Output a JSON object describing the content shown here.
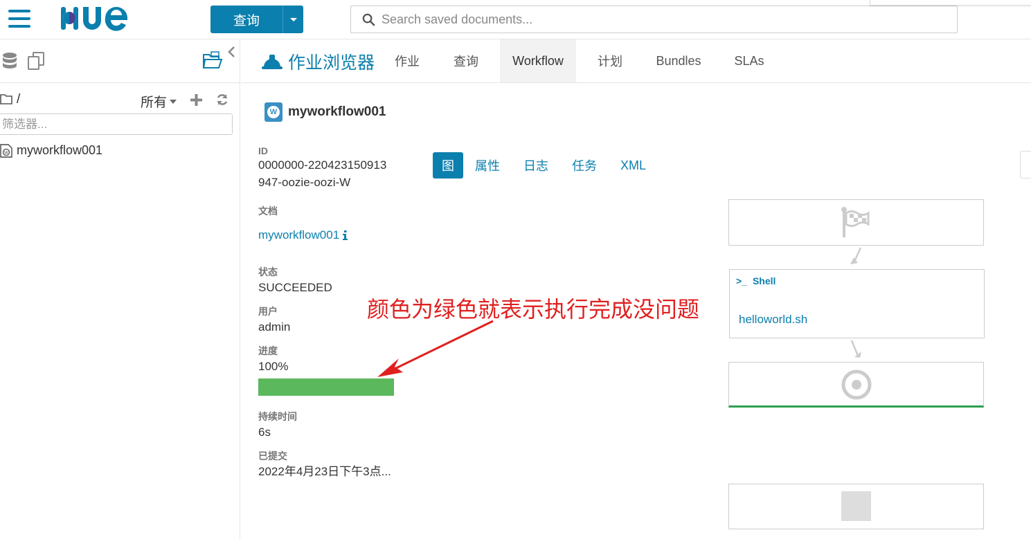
{
  "header": {
    "query_button_label": "查询",
    "search_placeholder": "Search saved documents..."
  },
  "sidebar": {
    "path": "/",
    "filter_all_label": "所有",
    "filter_placeholder": "筛选器...",
    "items": [
      {
        "label": "myworkflow001",
        "icon": "workflow-file-icon"
      }
    ]
  },
  "job_browser": {
    "title": "作业浏览器",
    "tabs": [
      "作业",
      "查询",
      "Workflow",
      "计划",
      "Bundles",
      "SLAs"
    ],
    "active_tab": "Workflow"
  },
  "workflow": {
    "name": "myworkflow001",
    "badge_letter": "W",
    "properties": {
      "id_label": "ID",
      "id_value_line1": "0000000-220423150913",
      "id_value_line2": "947-oozie-oozi-W",
      "doc_label": "文档",
      "doc_link": "myworkflow001",
      "status_label": "状态",
      "status_value": "SUCCEEDED",
      "user_label": "用户",
      "user_value": "admin",
      "progress_label": "进度",
      "progress_value": "100%",
      "progress_fraction": 1.0,
      "duration_label": "持续时间",
      "duration_value": "6s",
      "submitted_label": "已提交",
      "submitted_value": "2022年4月23日下午3点..."
    },
    "subtabs": [
      "图",
      "属性",
      "日志",
      "任务",
      "XML"
    ],
    "active_subtab": "图",
    "graph": {
      "shell_node_type": "Shell",
      "shell_node_prompt": ">_",
      "shell_node_script": "helloworld.sh"
    }
  },
  "annotation": {
    "text": "颜色为绿色就表示执行完成没问题",
    "color": "#e02020"
  },
  "colors": {
    "accent": "#0B7FAD",
    "success": "#5cb85c",
    "success_border": "#2e9e4e"
  }
}
